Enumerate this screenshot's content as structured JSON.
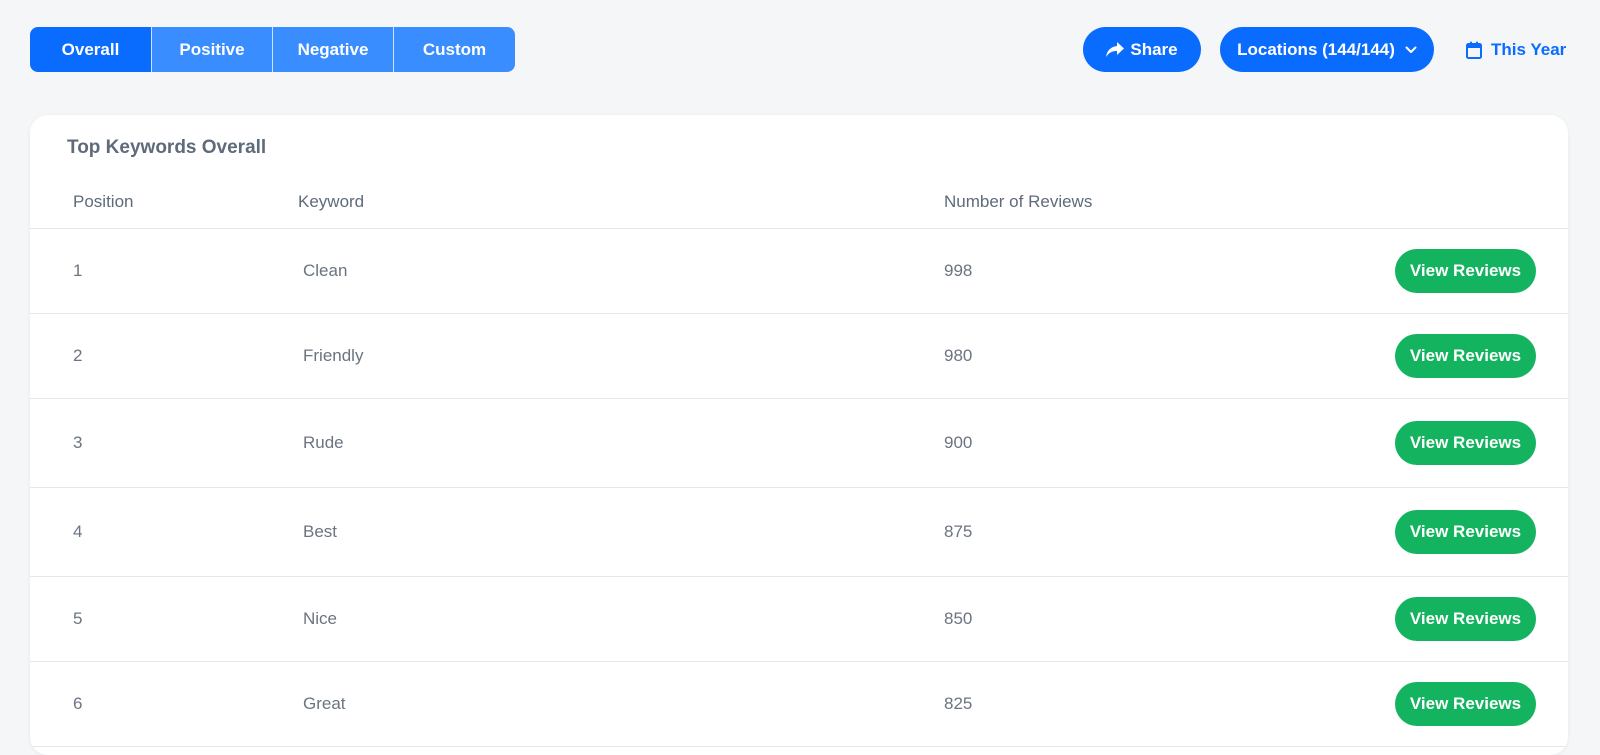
{
  "tabs": [
    {
      "label": "Overall",
      "active": true
    },
    {
      "label": "Positive",
      "active": false
    },
    {
      "label": "Negative",
      "active": false
    },
    {
      "label": "Custom",
      "active": false
    }
  ],
  "toolbar": {
    "share_label": "Share",
    "locations_label": "Locations (144/144)",
    "date_label": "This Year"
  },
  "card": {
    "title": "Top Keywords Overall",
    "columns": {
      "position": "Position",
      "keyword": "Keyword",
      "reviews": "Number of Reviews"
    },
    "rows": [
      {
        "position": "1",
        "keyword": "Clean",
        "reviews": "998",
        "action": "View Reviews"
      },
      {
        "position": "2",
        "keyword": "Friendly",
        "reviews": "980",
        "action": "View Reviews"
      },
      {
        "position": "3",
        "keyword": "Rude",
        "reviews": "900",
        "action": "View Reviews"
      },
      {
        "position": "4",
        "keyword": "Best",
        "reviews": "875",
        "action": "View Reviews"
      },
      {
        "position": "5",
        "keyword": "Nice",
        "reviews": "850",
        "action": "View Reviews"
      },
      {
        "position": "6",
        "keyword": "Great",
        "reviews": "825",
        "action": "View Reviews"
      }
    ]
  },
  "colors": {
    "primary": "#0a6cff",
    "tab_inactive": "#3a8dff",
    "success": "#13b35f",
    "background": "#f4f6f8",
    "text_muted": "#5f6b7a"
  },
  "icons": {
    "share": "share-arrow-icon",
    "locations": "chevron-down-icon",
    "date": "calendar-icon"
  }
}
